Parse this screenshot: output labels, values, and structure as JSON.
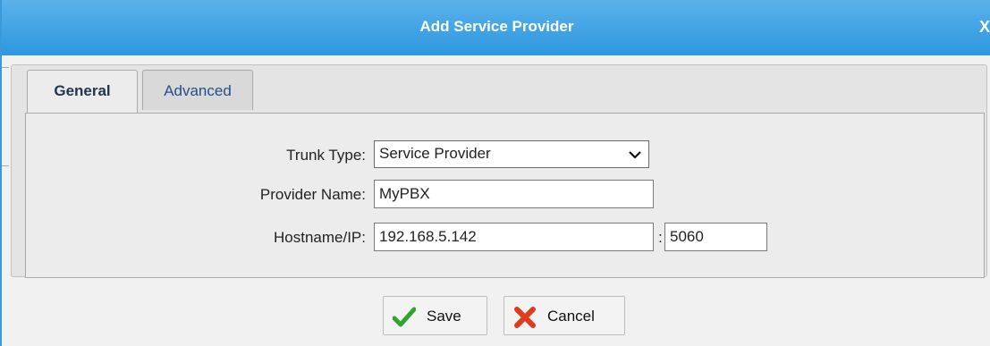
{
  "dialog": {
    "title": "Add Service Provider",
    "close_label": "X"
  },
  "tabs": [
    {
      "label": "General",
      "active": true
    },
    {
      "label": "Advanced",
      "active": false
    }
  ],
  "form": {
    "trunk_type": {
      "label": "Trunk Type:",
      "value": "Service Provider"
    },
    "provider_name": {
      "label": "Provider Name:",
      "value": "MyPBX"
    },
    "hostname": {
      "label": "Hostname/IP:",
      "value": "192.168.5.142",
      "port_separator": ":",
      "port": "5060"
    }
  },
  "buttons": {
    "save_label": "Save",
    "cancel_label": "Cancel"
  },
  "colors": {
    "titlebar": "#2d97e0",
    "save_icon": "#2fa52f",
    "cancel_icon": "#e03b1f"
  },
  "icons": {
    "save": "checkmark-icon",
    "cancel": "x-mark-icon",
    "trunk_dropdown": "chevron-down-icon"
  }
}
